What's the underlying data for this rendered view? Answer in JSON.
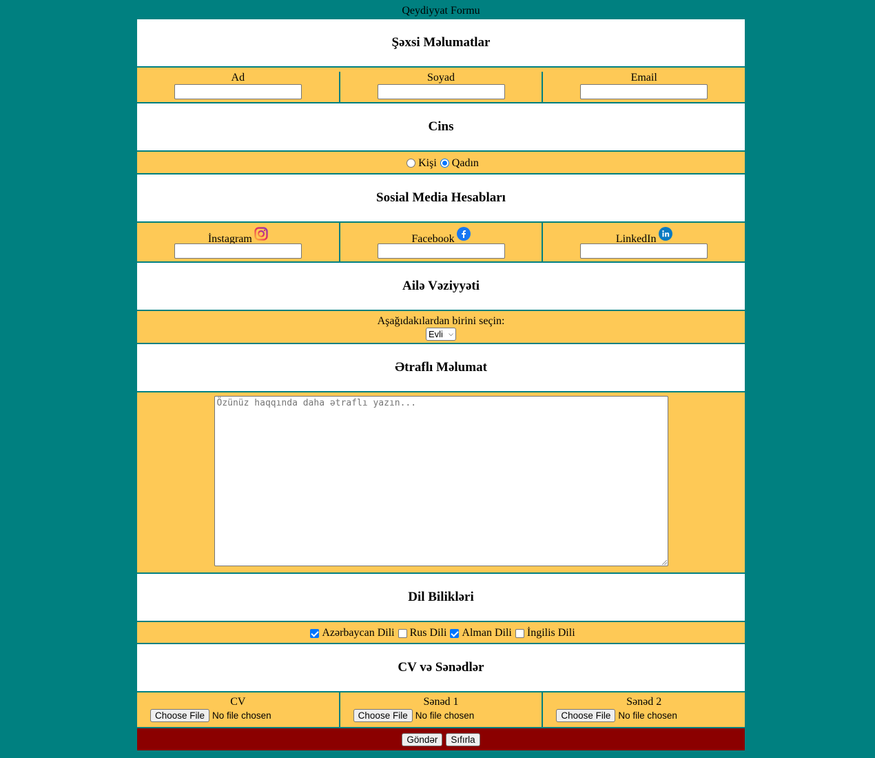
{
  "page": {
    "caption": "Qeydiyyat Formu"
  },
  "personal": {
    "heading": "Şəxsi Məlumatlar",
    "fields": [
      {
        "label": "Ad",
        "value": ""
      },
      {
        "label": "Soyad",
        "value": ""
      },
      {
        "label": "Email",
        "value": ""
      }
    ]
  },
  "gender": {
    "heading": "Cins",
    "options": [
      {
        "label": "Kişi",
        "selected": false
      },
      {
        "label": "Qadın",
        "selected": true
      }
    ]
  },
  "social": {
    "heading": "Sosial Media Hesabları",
    "fields": [
      {
        "label": "İnstagram",
        "icon": "instagram-icon",
        "value": ""
      },
      {
        "label": "Facebook",
        "icon": "facebook-icon",
        "value": ""
      },
      {
        "label": "LinkedIn",
        "icon": "linkedin-icon",
        "value": ""
      }
    ]
  },
  "family": {
    "heading": "Ailə Vəziyyəti",
    "prompt": "Aşağıdakılardan birini seçin:",
    "selected": "Evli"
  },
  "details": {
    "heading": "Ətraflı Məlumat",
    "placeholder": "Özünüz haqqında daha ətraflı yazın..."
  },
  "languages": {
    "heading": "Dil Bilikləri",
    "options": [
      {
        "label": "Azərbaycan Dili",
        "checked": true
      },
      {
        "label": "Rus Dili",
        "checked": false
      },
      {
        "label": "Alman Dili",
        "checked": true
      },
      {
        "label": "İngilis Dili",
        "checked": false
      }
    ]
  },
  "documents": {
    "heading": "CV və Sənədlər",
    "choose_label": "Choose File",
    "empty_label": "No file chosen",
    "files": [
      {
        "label": "CV"
      },
      {
        "label": "Sənəd 1"
      },
      {
        "label": "Sənəd 2"
      }
    ]
  },
  "actions": {
    "submit": "Göndər",
    "reset": "Sıfırla"
  },
  "colors": {
    "background": "#008080",
    "row": "#fec956",
    "actions_bar": "#8b0000",
    "accent": "#0075ff"
  }
}
